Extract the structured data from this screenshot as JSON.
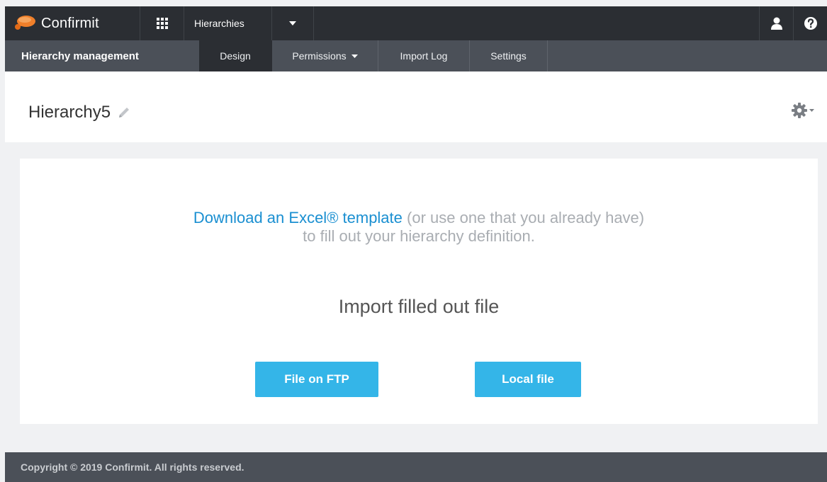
{
  "header": {
    "brand": "Confirmit",
    "module": "Hierarchies",
    "icons": [
      "apps-grid-icon",
      "caret-down-icon",
      "user-icon",
      "help-icon"
    ]
  },
  "subnav": {
    "title": "Hierarchy management",
    "items": [
      {
        "label": "Design",
        "active": true
      },
      {
        "label": "Permissions"
      },
      {
        "label": "Import Log"
      },
      {
        "label": "Settings"
      }
    ]
  },
  "page": {
    "title": "Hierarchy5"
  },
  "import": {
    "template_link": "Download an Excel® template",
    "template_suffix": "(or use one that you already have)",
    "template_line2": "to fill out your hierarchy definition.",
    "import_label": "Import filled out file",
    "ftp_button": "File on FTP",
    "local_button": "Local file"
  },
  "footer": {
    "copyright": "Copyright © 2019 Confirmit. All rights reserved."
  },
  "colors": {
    "topbar": "#2b2e33",
    "subnav": "#4b5058",
    "accent_button": "#34b5e8",
    "link": "#1a8fd1",
    "logo_orange": "#f07f2a"
  }
}
